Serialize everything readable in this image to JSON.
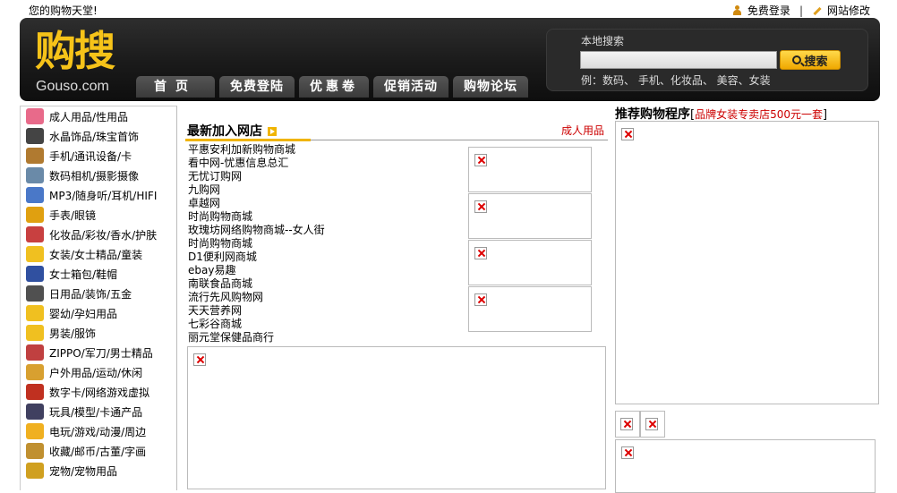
{
  "topbar": {
    "welcome": "您的购物天堂!",
    "register_label": "免费登录",
    "separator": "|",
    "site_edit_label": "网站修改"
  },
  "header": {
    "logo_cn": "购搜",
    "logo_en": "Gouso.com",
    "nav": [
      {
        "label": "首页"
      },
      {
        "label": "免费登陆"
      },
      {
        "label": "优惠卷"
      },
      {
        "label": "促销活动"
      },
      {
        "label": "购物论坛"
      }
    ],
    "search": {
      "title": "本地搜索",
      "input_value": "",
      "button_label": "搜索",
      "hint": "例：数码、 手机、化妆品、 美容、女装"
    }
  },
  "sidebar": {
    "items": [
      {
        "label": "成人用品/性用品",
        "color": "#e86a8a"
      },
      {
        "label": "水晶饰品/珠宝首饰",
        "color": "#444444"
      },
      {
        "label": "手机/通讯设备/卡",
        "color": "#b07a30"
      },
      {
        "label": "数码相机/摄影摄像",
        "color": "#6a8aa8"
      },
      {
        "label": "MP3/随身听/耳机/HIFI",
        "color": "#4a78c8"
      },
      {
        "label": "手表/眼镜",
        "color": "#e0a010"
      },
      {
        "label": "化妆品/彩妆/香水/护肤",
        "color": "#c84040"
      },
      {
        "label": "女装/女士精品/童装",
        "color": "#f0c020"
      },
      {
        "label": "女士箱包/鞋帽",
        "color": "#3050a0"
      },
      {
        "label": "日用品/装饰/五金",
        "color": "#505050"
      },
      {
        "label": "婴幼/孕妇用品",
        "color": "#f0c020"
      },
      {
        "label": "男装/服饰",
        "color": "#f0c020"
      },
      {
        "label": "ZIPPO/军刀/男士精品",
        "color": "#c04040"
      },
      {
        "label": "户外用品/运动/休闲",
        "color": "#d8a030"
      },
      {
        "label": "数字卡/网络游戏虚拟",
        "color": "#c03020"
      },
      {
        "label": "玩具/模型/卡通产品",
        "color": "#404060"
      },
      {
        "label": "电玩/游戏/动漫/周边",
        "color": "#f0b020"
      },
      {
        "label": "收藏/邮币/古董/字画",
        "color": "#c09030"
      },
      {
        "label": "宠物/宠物用品",
        "color": "#d0a020"
      }
    ]
  },
  "middle": {
    "section_title": "最新加入网店",
    "section_more": "成人用品",
    "shops": [
      "平惠安利加新购物商城",
      "看中网-忧惠信息总汇",
      "无忧订购网",
      "九购网",
      "卓越网",
      "时尚购物商城",
      "玫瑰坊网络购物商城--女人街",
      "时尚购物商城",
      "D1便利网商城",
      "ebay易趣",
      "南联食品商城",
      "流行先风购物网",
      "天天营养网",
      "七彩谷商城",
      "丽元堂保健品商行"
    ]
  },
  "right": {
    "title": "推荐购物程序",
    "link": "品牌女装专卖店500元一套",
    "bracket_open": "[",
    "bracket_close": "]"
  }
}
